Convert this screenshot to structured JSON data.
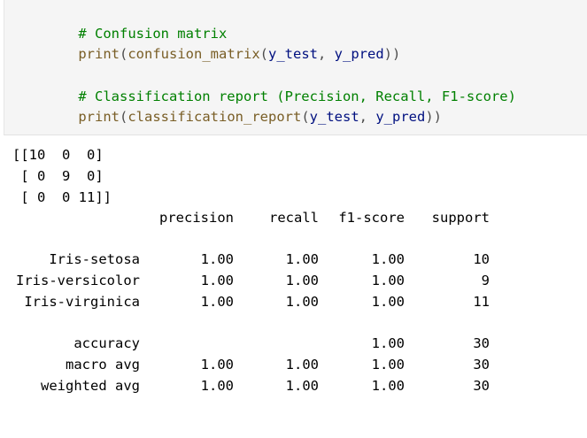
{
  "input_cell": {
    "line1_comment": "# Confusion matrix",
    "line2": {
      "print": "print",
      "open": "(",
      "fn": "confusion_matrix",
      "open2": "(",
      "arg1": "y_test",
      "comma": ", ",
      "arg2": "y_pred",
      "close": "))"
    },
    "line3_comment": "# Classification report (Precision, Recall, F1-score)",
    "line4": {
      "print": "print",
      "open": "(",
      "fn": "classification_report",
      "open2": "(",
      "arg1": "y_test",
      "comma": ", ",
      "arg2": "y_pred",
      "close": "))"
    }
  },
  "output": {
    "matrix_lines": [
      "[[10  0  0]",
      " [ 0  9  0]",
      " [ 0  0 11]]"
    ],
    "report_headers": [
      "precision",
      "recall",
      "f1-score",
      "support"
    ],
    "report_rows": [
      {
        "label": "Iris-setosa",
        "precision": "1.00",
        "recall": "1.00",
        "f1": "1.00",
        "support": "10"
      },
      {
        "label": "Iris-versicolor",
        "precision": "1.00",
        "recall": "1.00",
        "f1": "1.00",
        "support": "9"
      },
      {
        "label": "Iris-virginica",
        "precision": "1.00",
        "recall": "1.00",
        "f1": "1.00",
        "support": "11"
      }
    ],
    "summary_rows": [
      {
        "label": "accuracy",
        "precision": "",
        "recall": "",
        "f1": "1.00",
        "support": "30"
      },
      {
        "label": "macro avg",
        "precision": "1.00",
        "recall": "1.00",
        "f1": "1.00",
        "support": "30"
      },
      {
        "label": "weighted avg",
        "precision": "1.00",
        "recall": "1.00",
        "f1": "1.00",
        "support": "30"
      }
    ]
  }
}
